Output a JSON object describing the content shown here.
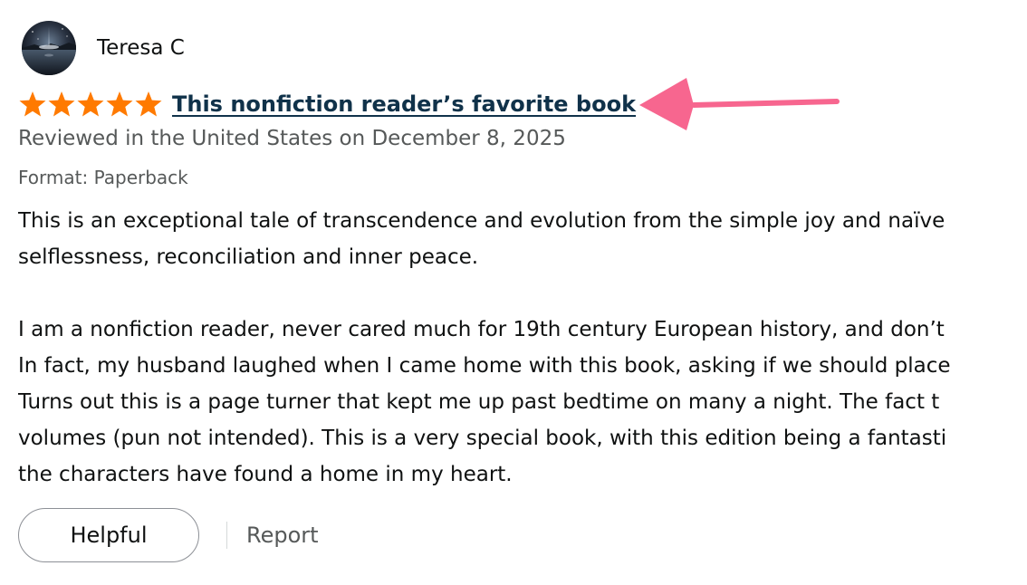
{
  "reviewer": {
    "name": "Teresa C",
    "avatar_icon": "profile-photo-night-sky"
  },
  "rating": {
    "stars": 5,
    "max": 5,
    "star_color": "#ff7a00"
  },
  "review": {
    "title": "This nonfiction reader’s favorite book",
    "title_color": "#10324a",
    "date_line": "Reviewed in the United States on December 8, 2025",
    "format": "Format: Paperback",
    "paragraph1": [
      "This is an exceptional tale of transcendence and evolution from the simple joy and naïve",
      "selflessness, reconciliation and inner peace."
    ],
    "paragraph2": [
      "I am a nonfiction reader, never cared much for 19th century European history, and don’t",
      "In fact, my husband laughed when I came home with this book, asking if we should place",
      "Turns out this is a page turner that kept me up past bedtime on many a night. The fact t",
      "volumes (pun not intended). This is a very special book, with this edition being a fantasti",
      "the characters have found a home in my heart."
    ]
  },
  "actions": {
    "helpful_label": "Helpful",
    "report_label": "Report"
  },
  "annotation": {
    "arrow_icon": "pink-arrow-pointing-left",
    "arrow_color": "#f7668f"
  }
}
